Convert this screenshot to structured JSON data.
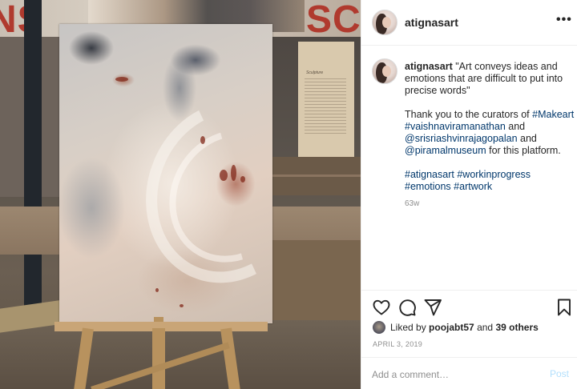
{
  "photo": {
    "banner_left_text": "NS",
    "banner_right_text": "SCU",
    "exhibit_title": "Sculpture"
  },
  "header": {
    "username": "atignasart",
    "more_label": "•••"
  },
  "caption": {
    "username": "atignasart",
    "quote": "\"Art conveys ideas and emotions that are difficult to put into precise words\"",
    "thanks_prefix": "Thank you to the curators of",
    "mention_1": "#Makeart",
    "mention_2": "#vaishnaviramanathan",
    "and_1": "and",
    "mention_3": "@srisriashvinrajagopalan",
    "and_2": "and",
    "mention_4": "@piramalmuseum",
    "thanks_suffix": "for this platform.",
    "hashtags": [
      "#atignasart",
      "#workinprogress",
      "#emotions",
      "#artwork"
    ],
    "age": "63w"
  },
  "actions": {
    "icons": [
      "heart-icon",
      "comment-icon",
      "share-icon",
      "bookmark-icon"
    ]
  },
  "likes": {
    "prefix": "Liked by",
    "user": "poojabt57",
    "joiner": "and",
    "others": "39 others"
  },
  "date": "APRIL 3, 2019",
  "comment": {
    "placeholder": "Add a comment…",
    "post_label": "Post"
  },
  "colors": {
    "link": "#00376b",
    "post_disabled": "#b2dffc",
    "meta_gray": "#8e8e8e"
  }
}
